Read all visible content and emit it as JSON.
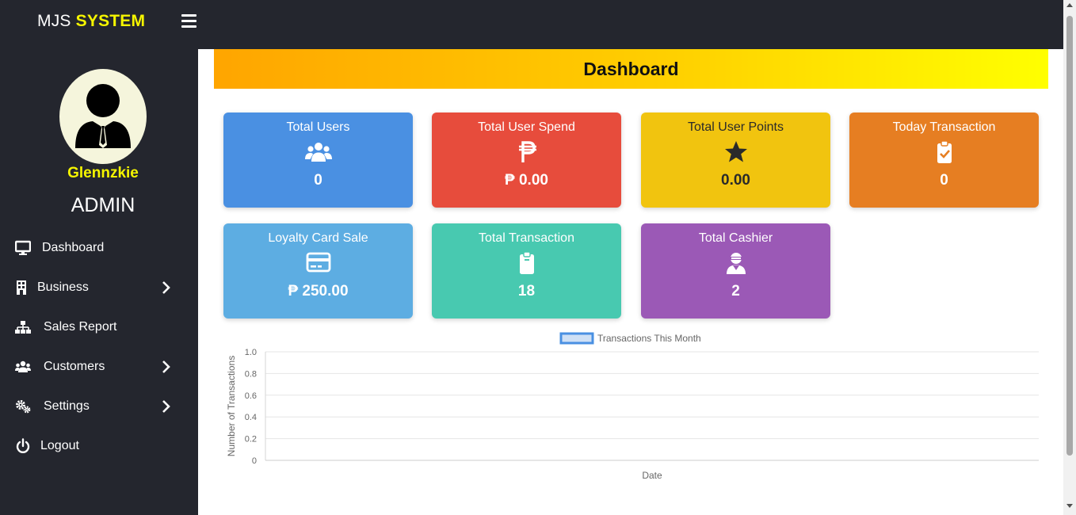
{
  "app": {
    "brand_main": "MJS",
    "brand_accent": "SYSTEM"
  },
  "user": {
    "name": "Glennzkie",
    "role": "ADMIN"
  },
  "sidebar": {
    "items": [
      {
        "label": "Dashboard",
        "icon": "monitor-icon",
        "has_submenu": false
      },
      {
        "label": "Business",
        "icon": "building-icon",
        "has_submenu": true
      },
      {
        "label": "Sales Report",
        "icon": "sitemap-icon",
        "has_submenu": false
      },
      {
        "label": "Customers",
        "icon": "users-icon",
        "has_submenu": true
      },
      {
        "label": "Settings",
        "icon": "cogs-icon",
        "has_submenu": true
      },
      {
        "label": "Logout",
        "icon": "power-icon",
        "has_submenu": false
      }
    ]
  },
  "page": {
    "title": "Dashboard"
  },
  "cards": [
    {
      "title": "Total Users",
      "value": "0",
      "icon": "users-icon",
      "color": "#4a90e2"
    },
    {
      "title": "Total User Spend",
      "value": "₱ 0.00",
      "icon": "peso-icon",
      "color": "#e74c3c"
    },
    {
      "title": "Total User Points",
      "value": "0.00",
      "icon": "star-icon",
      "color": "#f1c40f"
    },
    {
      "title": "Today Transaction",
      "value": "0",
      "icon": "clipboard-check-icon",
      "color": "#e67e22"
    },
    {
      "title": "Loyalty Card Sale",
      "value": "₱ 250.00",
      "icon": "credit-card-icon",
      "color": "#5dade2"
    },
    {
      "title": "Total Transaction",
      "value": "18",
      "icon": "clipboard-icon",
      "color": "#48c9b0"
    },
    {
      "title": "Total Cashier",
      "value": "2",
      "icon": "user-cashier-icon",
      "color": "#9b59b6"
    }
  ],
  "chart_data": {
    "type": "line",
    "series": [
      {
        "name": "Transactions This Month",
        "values": []
      }
    ],
    "categories": [],
    "xlabel": "Date",
    "ylabel": "Number of Transactions",
    "ylim": [
      0,
      1.0
    ],
    "yticks": [
      "1.0",
      "0.8",
      "0.6",
      "0.4",
      "0.2",
      "0"
    ],
    "grid": true,
    "legend_position": "top-center",
    "legend_color": "#4a90e2"
  }
}
